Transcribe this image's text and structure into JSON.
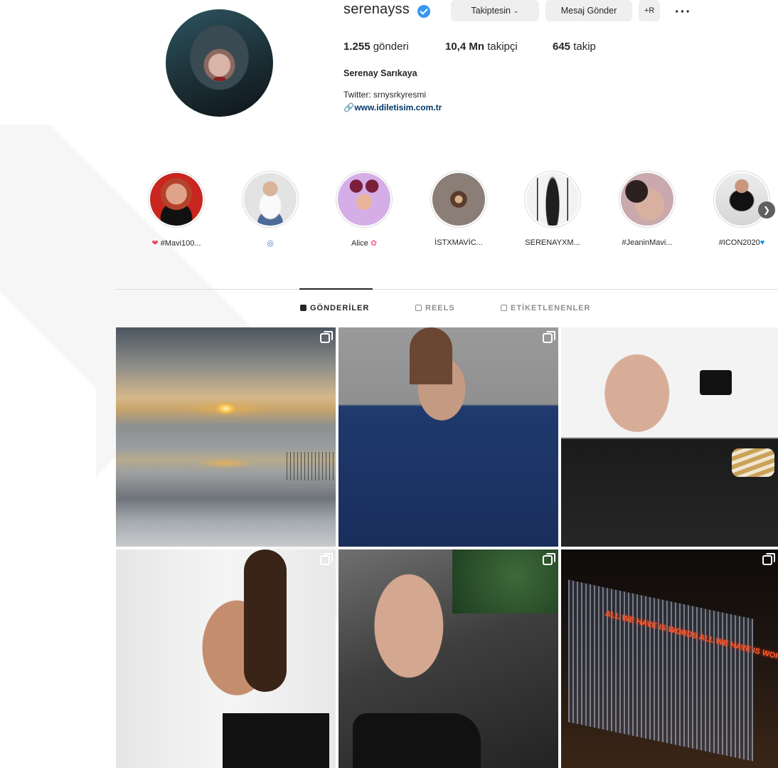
{
  "profile": {
    "username": "serenayss",
    "follow_button": "Takiptesin",
    "message_button": "Mesaj Gönder",
    "add_user_label": "+R",
    "more_label": "···",
    "stats": {
      "posts_count": "1.255",
      "posts_label": "gönderi",
      "followers_count": "10,4 Mn",
      "followers_label": "takipçi",
      "following_count": "645",
      "following_label": "takip"
    },
    "full_name": "Serenay Sarıkaya",
    "bio_line": "Twitter: srnysrkyresmi",
    "link": "www.idiletisim.com.tr"
  },
  "highlights": [
    {
      "label": "#Mavi100...",
      "prefix": "❤",
      "suffix": ""
    },
    {
      "label": "",
      "prefix": "",
      "suffix": "◎"
    },
    {
      "label": "Alice",
      "prefix": "",
      "suffix": "✿"
    },
    {
      "label": "İSTXMAVİC...",
      "prefix": "",
      "suffix": ""
    },
    {
      "label": "SERENAYXM...",
      "prefix": "",
      "suffix": ""
    },
    {
      "label": "#JeaninMavi...",
      "prefix": "",
      "suffix": ""
    },
    {
      "label": "#ICON2020",
      "prefix": "",
      "suffix": "♥"
    }
  ],
  "tabs": [
    {
      "label": "GÖNDERİLER",
      "active": true
    },
    {
      "label": "REELS",
      "active": false
    },
    {
      "label": "ETİKETLENENLER",
      "active": false
    }
  ],
  "posts": [
    {
      "multi": true
    },
    {
      "multi": true
    },
    {
      "multi": false
    },
    {
      "multi": true
    },
    {
      "multi": true
    },
    {
      "multi": true,
      "neon_text": "ALL WE HAVE IS WORDS ALL WE HAVE IS WORDS"
    }
  ],
  "colors": {
    "verified_blue": "#3897f0",
    "button_bg": "#efefef",
    "link_blue": "#00376b"
  }
}
